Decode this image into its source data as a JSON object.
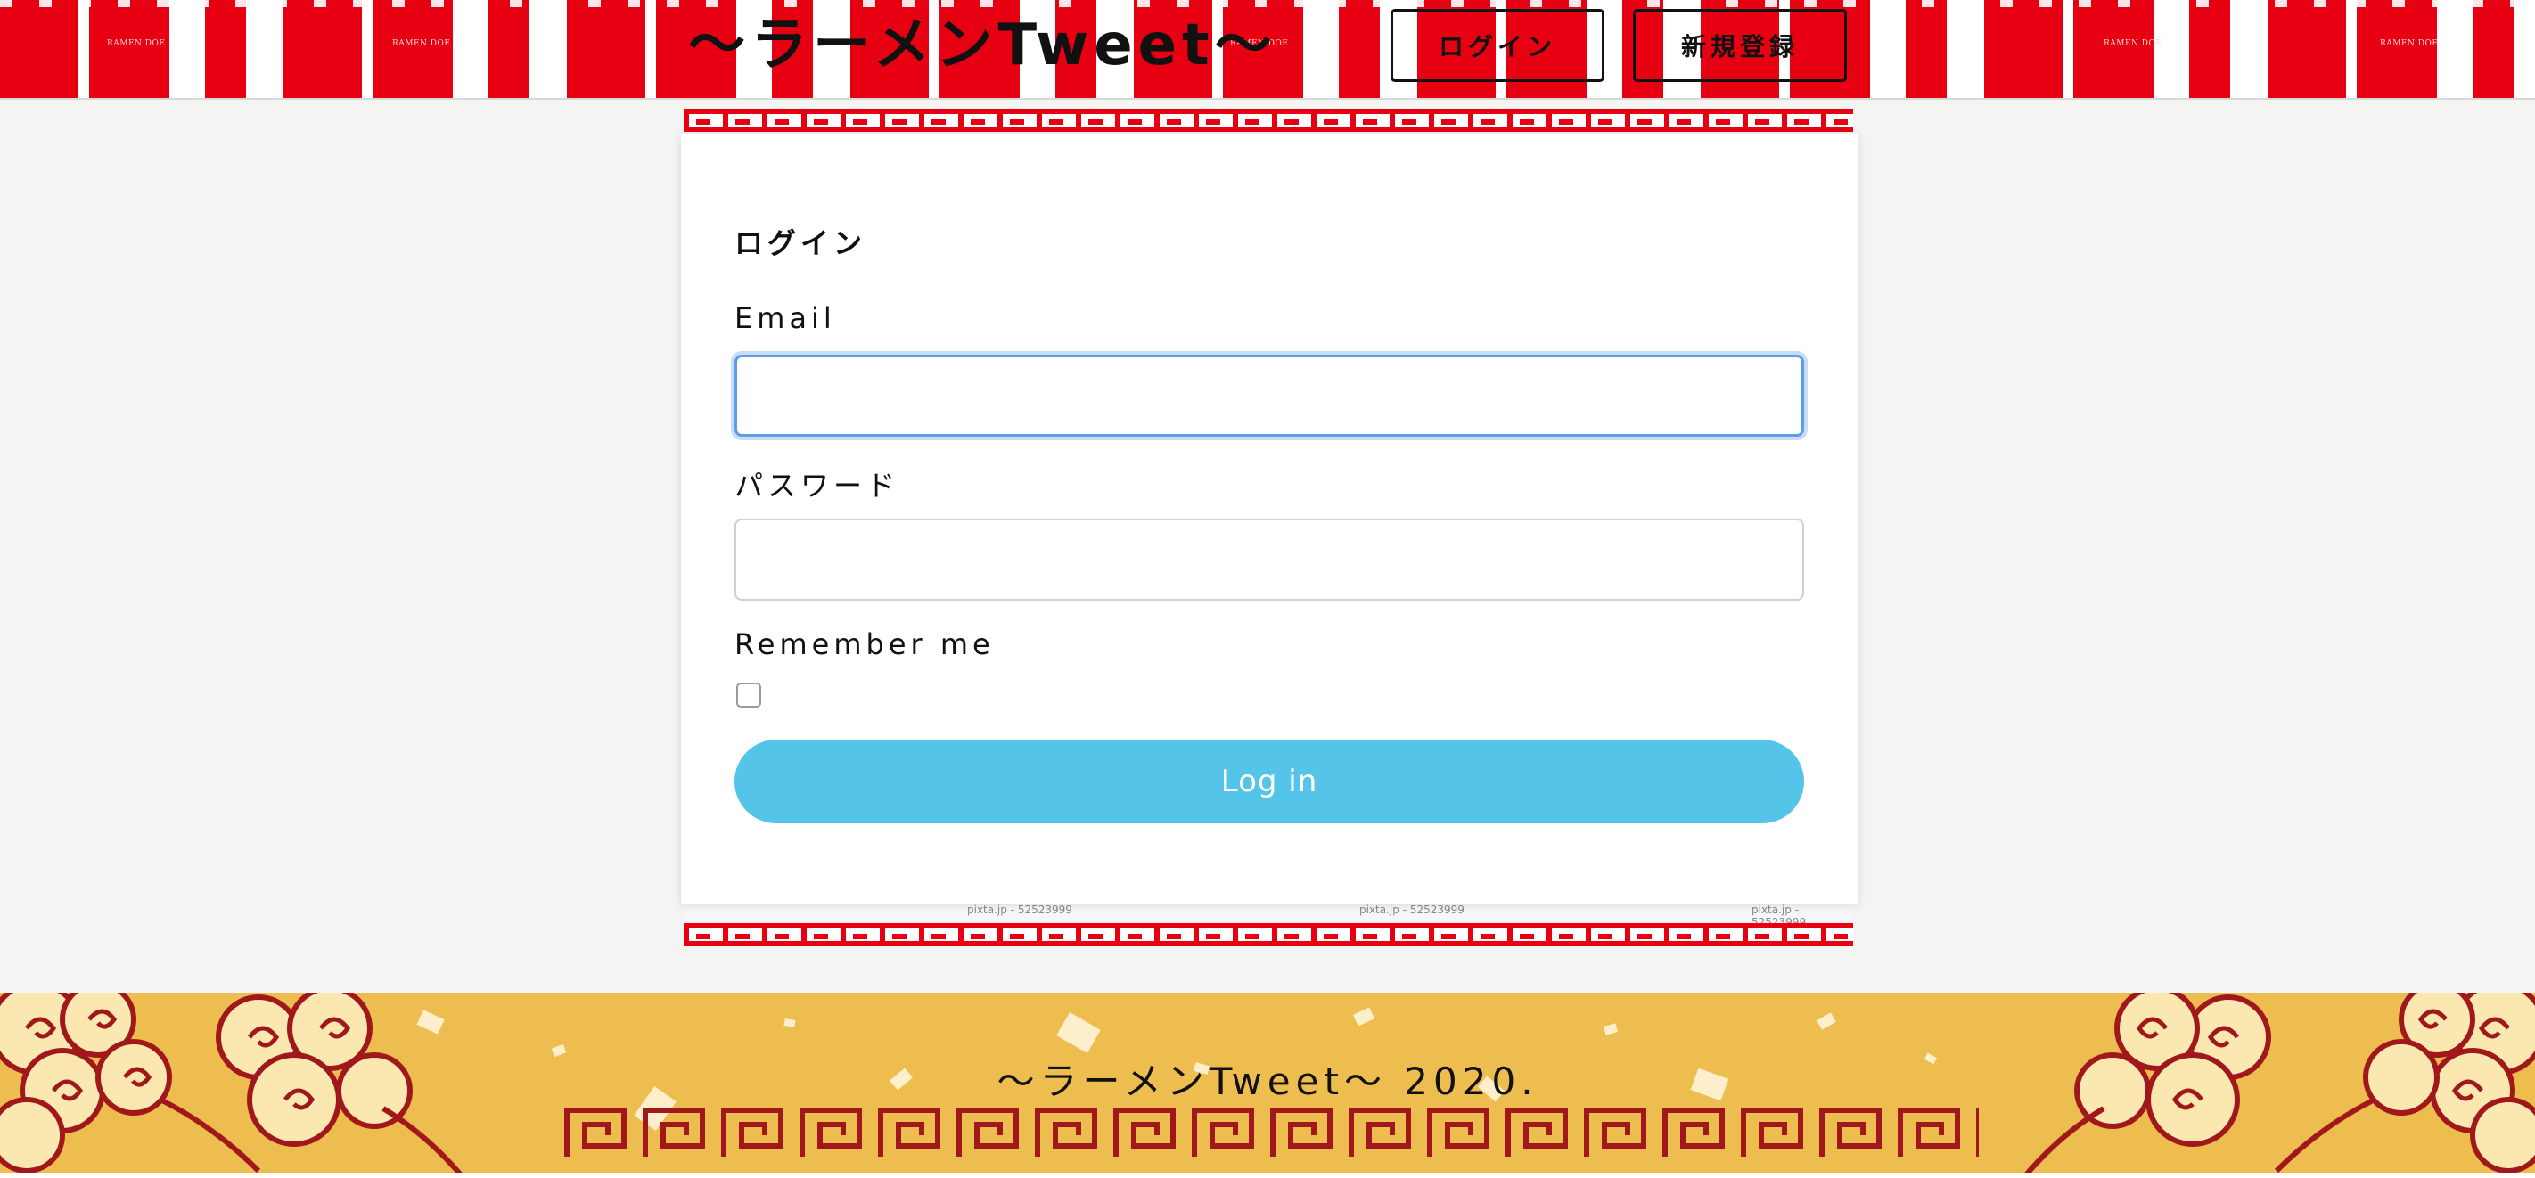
{
  "header": {
    "site_title": "〜ラーメンTweet〜",
    "login_button": "ログイン",
    "signup_button": "新規登録",
    "stripe_tag": "RAMEN DOE"
  },
  "form": {
    "heading": "ログイン",
    "email_label": "Email",
    "email_value": "",
    "password_label": "パスワード",
    "password_value": "",
    "remember_label": "Remember me",
    "remember_checked": false,
    "submit_label": "Log in"
  },
  "watermark": "pixta.jp - 52523999",
  "footer": {
    "copyright": "〜ラーメンTweet〜 2020."
  },
  "colors": {
    "header_red": "#e60012",
    "focus_blue": "#5b9ee6",
    "button_blue": "#54c4e8",
    "footer_gold": "#eebd4f",
    "cloud_red": "#a0181c",
    "cloud_cream": "#fbe8b0"
  }
}
